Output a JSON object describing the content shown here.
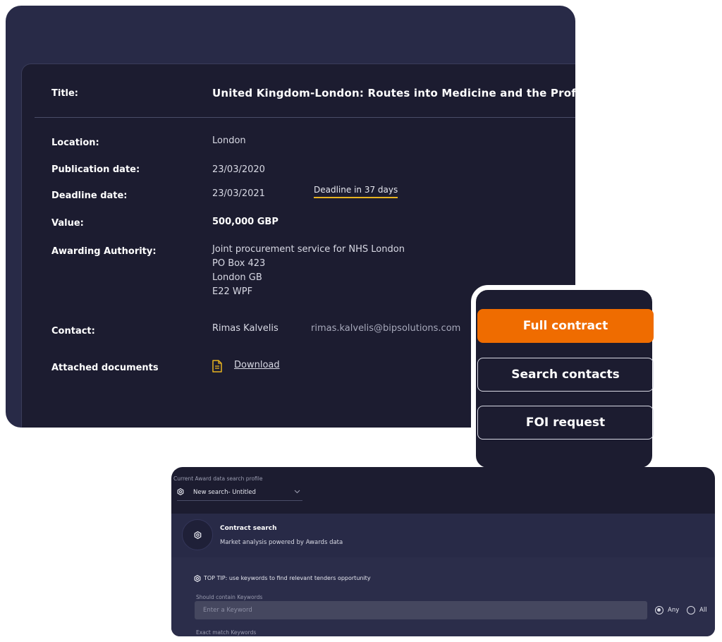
{
  "details": {
    "title_label": "Title:",
    "title_value": "United Kingdom-London: Routes into Medicine and the Professions - Hea",
    "location_label": "Location:",
    "location_value": "London",
    "publication_label": "Publication date:",
    "publication_value": "23/03/2020",
    "deadline_label": "Deadline date:",
    "deadline_value": "23/03/2021",
    "deadline_badge": "Deadline in 37 days",
    "value_label": "Value:",
    "value_value": "500,000 GBP",
    "authority_label": "Awarding Authority:",
    "authority_lines": [
      "Joint procurement service for NHS London",
      "PO Box 423",
      "London GB",
      "E22 WPF"
    ],
    "contact_label": "Contact:",
    "contact_name": "Rimas Kalvelis",
    "contact_email": "rimas.kalvelis@bipsolutions.com",
    "documents_label": "Attached documents",
    "download_label": "Download",
    "doc_icon": "document-icon"
  },
  "actions": {
    "full_contract": "Full contract",
    "search_contacts": "Search contacts",
    "foi_request": "FOI request"
  },
  "search": {
    "profile_label": "Current Award data search profile",
    "profile_value": "New search- Untitled",
    "contract_search_title": "Contract search",
    "contract_search_subtitle": "Market analysis powered by Awards data",
    "top_tip": "TOP TIP: use keywords to find relevant tenders opportunity",
    "keywords_label": "Should contain Keywords",
    "keywords_placeholder": "Enter a Keyword",
    "radio_any": "Any",
    "radio_all": "All",
    "radio_selected": "Any",
    "exact_label": "Exact match Keywords"
  },
  "colors": {
    "accent_orange": "#ef6c00",
    "deadline_underline": "#e8b320",
    "panel_dark": "#1c1c30",
    "panel_mid": "#282a47"
  }
}
